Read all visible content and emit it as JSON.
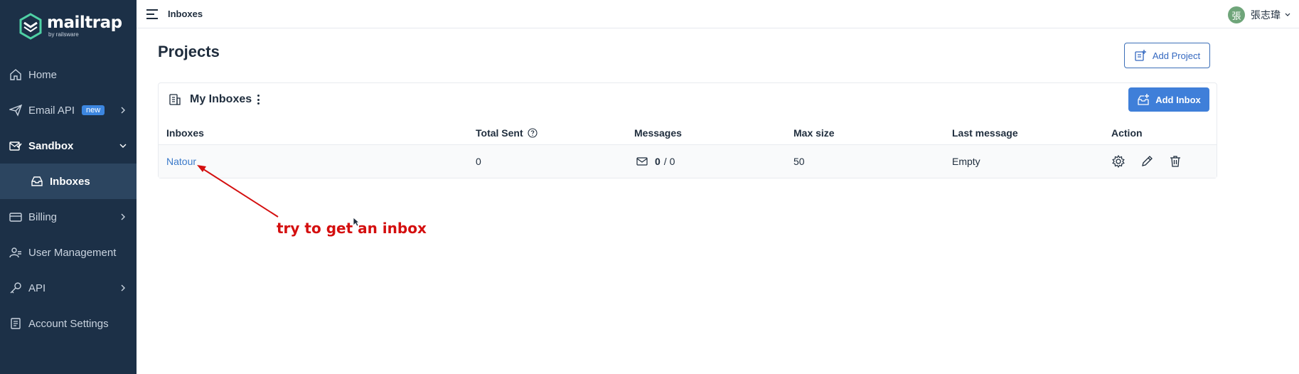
{
  "brand": {
    "name": "mailtrap",
    "sub": "by railsware"
  },
  "sidebar": {
    "items": [
      {
        "label": "Home",
        "icon": "home-icon"
      },
      {
        "label": "Email API",
        "icon": "send-icon",
        "badge": "new"
      },
      {
        "label": "Sandbox",
        "icon": "sandbox-icon"
      },
      {
        "label": "Inboxes",
        "icon": "inbox-icon"
      },
      {
        "label": "Billing",
        "icon": "billing-icon"
      },
      {
        "label": "User Management",
        "icon": "users-icon"
      },
      {
        "label": "API",
        "icon": "key-icon"
      },
      {
        "label": "Account Settings",
        "icon": "settings-doc-icon"
      }
    ]
  },
  "topbar": {
    "title": "Inboxes",
    "user_name": "張志瑋",
    "avatar_char": "張"
  },
  "main": {
    "title": "Projects",
    "add_project_label": "Add Project",
    "project": {
      "name": "My Inboxes",
      "add_inbox_label": "Add Inbox",
      "columns": [
        "Inboxes",
        "Total Sent",
        "Messages",
        "Max size",
        "Last message",
        "Action"
      ],
      "rows": [
        {
          "inbox": "Natour",
          "total_sent": "0",
          "messages_unread": "0",
          "messages_total": "/ 0",
          "max_size": "50",
          "last_message": "Empty"
        }
      ]
    }
  },
  "annotation": {
    "text": "try to get an inbox",
    "color": "#d40f0f"
  },
  "colors": {
    "sidebar_bg": "#1c3047",
    "accent": "#3f7fd9"
  }
}
